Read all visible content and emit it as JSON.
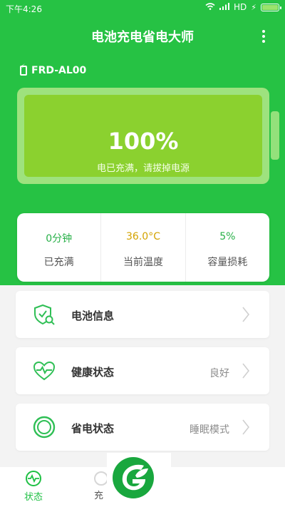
{
  "status_bar": {
    "time": "下午4:26",
    "network_label": "HD"
  },
  "app": {
    "title": "电池充电省电大师"
  },
  "device": {
    "name": "FRD-AL00"
  },
  "battery": {
    "percent_text": "100%",
    "charge_level": 1.0,
    "message": "电已充满，请拔掉电源"
  },
  "stats": [
    {
      "value": "0分钟",
      "label": "已充满",
      "color": "#27b048"
    },
    {
      "value": "36.0°C",
      "label": "当前温度",
      "color": "#d3a300"
    },
    {
      "value": "5%",
      "label": "容量损耗",
      "color": "#27b048"
    }
  ],
  "menu": [
    {
      "label": "电池信息",
      "value": "",
      "icon": "shield-search-icon"
    },
    {
      "label": "健康状态",
      "value": "良好",
      "icon": "heart-pulse-icon"
    },
    {
      "label": "省电状态",
      "value": "睡眠模式",
      "icon": "ring-icon"
    }
  ],
  "bottom_nav": {
    "tabs": [
      {
        "label": "状态",
        "icon": "pulse-icon",
        "active": true
      },
      {
        "label": "充",
        "icon": "circle-icon",
        "active": false
      }
    ]
  },
  "colors": {
    "primary": "#26c244",
    "battery_fill": "#8bd12f",
    "accent_orange": "#d3a300"
  }
}
